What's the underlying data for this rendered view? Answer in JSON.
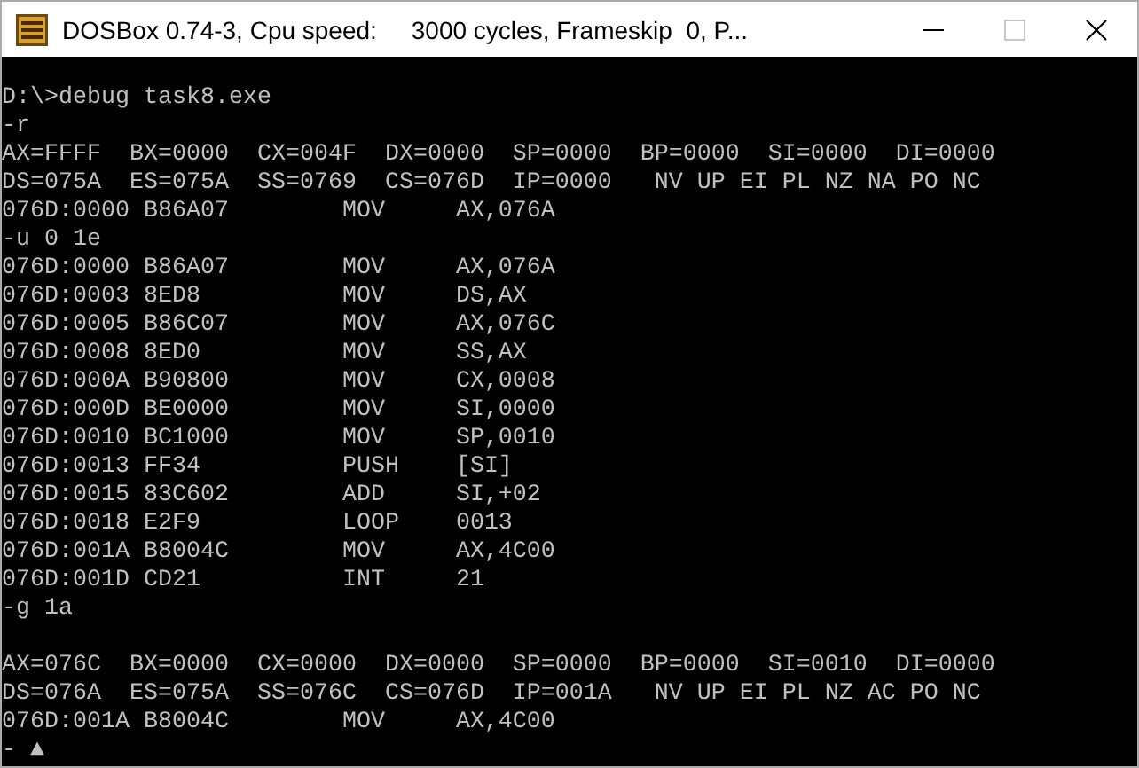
{
  "window": {
    "title": "DOSBox 0.74-3, Cpu speed:     3000 cycles, Frameskip  0, P...",
    "controls": [
      {
        "kind": "minimize",
        "disabled": false
      },
      {
        "kind": "maximize",
        "disabled": true
      },
      {
        "kind": "close",
        "disabled": false
      }
    ]
  },
  "console": {
    "blocks": [
      [
        "D:\\>debug task8.exe",
        "-r",
        "AX=FFFF  BX=0000  CX=004F  DX=0000  SP=0000  BP=0000  SI=0000  DI=0000",
        "DS=075A  ES=075A  SS=0769  CS=076D  IP=0000   NV UP EI PL NZ NA PO NC",
        "076D:0000 B86A07        MOV     AX,076A",
        "-u 0 1e",
        "076D:0000 B86A07        MOV     AX,076A",
        "076D:0003 8ED8          MOV     DS,AX",
        "076D:0005 B86C07        MOV     AX,076C",
        "076D:0008 8ED0          MOV     SS,AX",
        "076D:000A B90800        MOV     CX,0008",
        "076D:000D BE0000        MOV     SI,0000",
        "076D:0010 BC1000        MOV     SP,0010",
        "076D:0013 FF34          PUSH    [SI]",
        "076D:0015 83C602        ADD     SI,+02",
        "076D:0018 E2F9          LOOP    0013",
        "076D:001A B8004C        MOV     AX,4C00",
        "076D:001D CD21          INT     21",
        "-g 1a"
      ],
      [
        "AX=076C  BX=0000  CX=0000  DX=0000  SP=0000  BP=0000  SI=0010  DI=0000",
        "DS=076A  ES=075A  SS=076C  CS=076D  IP=001A   NV UP EI PL NZ AC PO NC",
        "076D:001A B8004C        MOV     AX,4C00",
        "- ▲"
      ]
    ]
  }
}
